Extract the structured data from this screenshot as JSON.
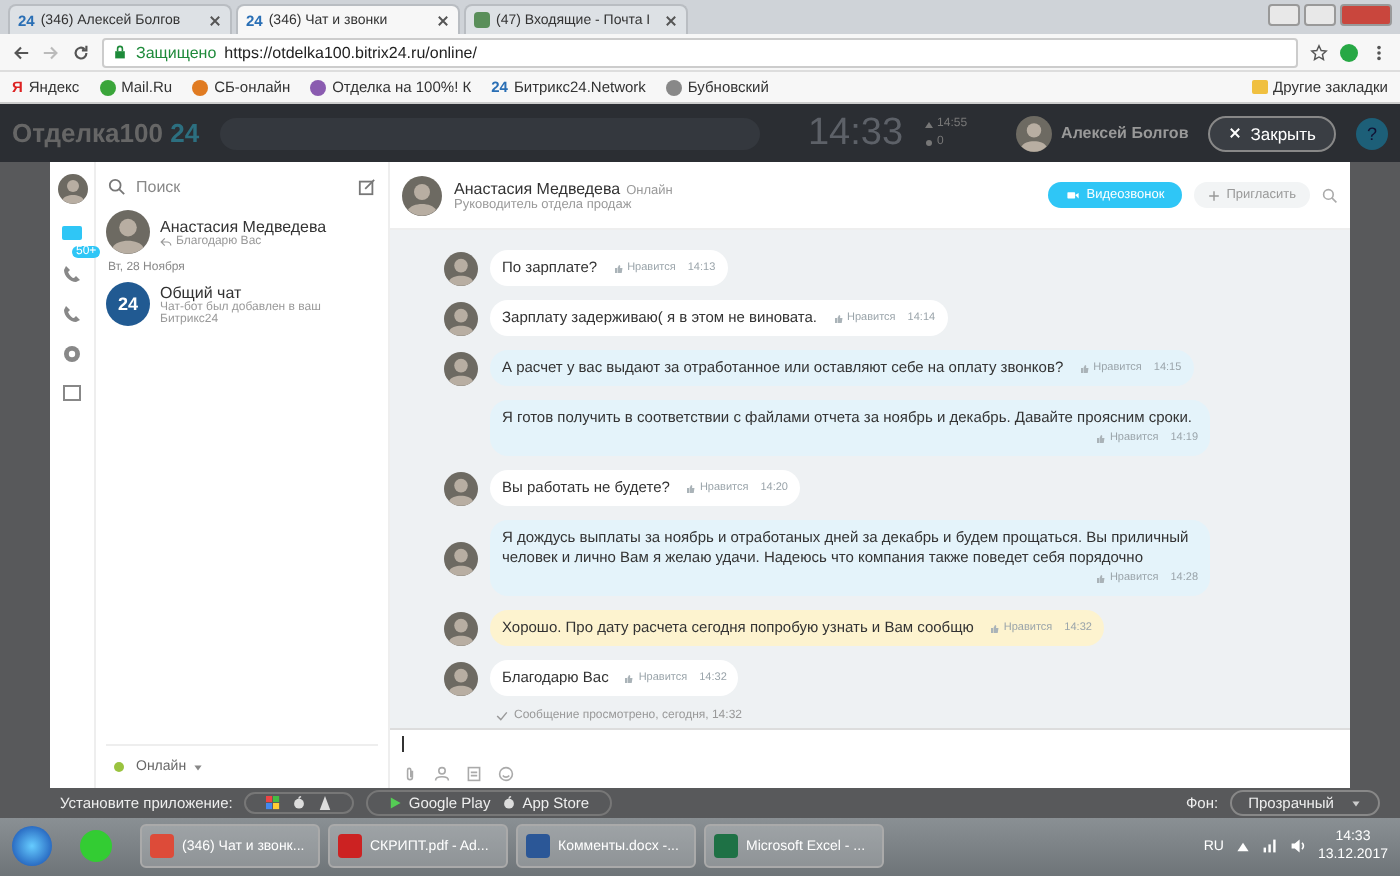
{
  "browser": {
    "tabs": [
      {
        "icon": "24",
        "label": "(346) Алексей Болгов",
        "selected": false
      },
      {
        "icon": "24",
        "label": "(346) Чат и звонки",
        "selected": true
      },
      {
        "label": "(47) Входящие - Почта I",
        "selected": false
      }
    ],
    "secure_label": "Защищено",
    "url": "https://otdelka100.bitrix24.ru/online/",
    "bookmarks": [
      {
        "label": "Яндекс",
        "icon": "Я"
      },
      {
        "label": "Mail.Ru"
      },
      {
        "label": "СБ-онлайн"
      },
      {
        "label": "Отделка на 100%! К"
      },
      {
        "label": "Битрикс24.Network",
        "icon": "24"
      },
      {
        "label": "Бубновский"
      }
    ],
    "other_bookmarks": "Другие закладки"
  },
  "header": {
    "logo": "Отделка100",
    "logo_accent": "24",
    "clock": "14:33",
    "stat_time": "14:55",
    "stat_count": "0",
    "user": "Алексей Болгов",
    "close": "Закрыть",
    "help": "?"
  },
  "messenger": {
    "badge": "50+",
    "search": {
      "placeholder": "Поиск"
    },
    "recent": [
      {
        "kind": "user",
        "name": "Анастасия Медведева",
        "preview": "Благодарю Вас"
      },
      {
        "kind": "date",
        "label": "Вт, 28 Ноября"
      },
      {
        "kind": "group",
        "avatar": "24",
        "name": "Общий чат",
        "preview": "Чат-бот был добавлен в ваш Битрикс24"
      }
    ],
    "status": "Онлайн"
  },
  "chat": {
    "name": "Анастасия Медведева",
    "presence": "Онлайн",
    "role": "Руководитель отдела продаж",
    "video": "Видеозвонок",
    "invite": "Пригласить",
    "messages": [
      {
        "kind": "incoming",
        "avatar": true,
        "text": "По зарплате?",
        "like": "Нравится",
        "time": "14:13"
      },
      {
        "kind": "incoming",
        "avatar": true,
        "text": "Зарплату задерживаю( я в этом не виновата.",
        "like": "Нравится",
        "time": "14:14"
      },
      {
        "kind": "outgoing",
        "avatar": true,
        "text": "А расчет у вас выдают за отработанное или оставляют себе на оплату звонков?",
        "like": "Нравится",
        "time": "14:15"
      },
      {
        "kind": "outgoing",
        "avatar": false,
        "text": "Я готов получить в соответствии с файлами отчета за ноябрь и декабрь. Давайте проясним сроки.",
        "like": "Нравится",
        "time": "14:19"
      },
      {
        "kind": "incoming",
        "avatar": true,
        "text": "Вы работать не будете?",
        "like": "Нравится",
        "time": "14:20"
      },
      {
        "kind": "outgoing",
        "avatar": true,
        "text": "Я дождусь выплаты за ноябрь и отработаных дней за декабрь и будем прощаться. Вы приличный человек и лично Вам я желаю удачи. Надеюсь что компания также поведет себя порядочно",
        "like": "Нравится",
        "time": "14:28"
      },
      {
        "kind": "highlighted",
        "avatar": true,
        "text": "Хорошо. Про дату расчета сегодня попробую узнать и Вам сообщю",
        "like": "Нравится",
        "time": "14:32"
      },
      {
        "kind": "incoming",
        "avatar": true,
        "text": "Благодарю Вас",
        "like": "Нравится",
        "time": "14:32"
      }
    ],
    "read_notice": "Сообщение просмотрено, сегодня, 14:32"
  },
  "apps_bar": {
    "label": "Установите приложение:",
    "stores": [
      "Google Play",
      "App Store"
    ],
    "background_label": "Фон:",
    "background_value": "Прозрачный"
  },
  "taskbar": {
    "items": [
      {
        "kind": "browser",
        "label": "(346) Чат и звонк..."
      },
      {
        "kind": "pdf",
        "label": "СКРИПТ.pdf - Ad..."
      },
      {
        "kind": "word",
        "label": "Комменты.docx -..."
      },
      {
        "kind": "excel",
        "label": "Microsoft Excel - ..."
      }
    ],
    "lang": "RU",
    "time": "14:33",
    "date": "13.12.2017"
  }
}
